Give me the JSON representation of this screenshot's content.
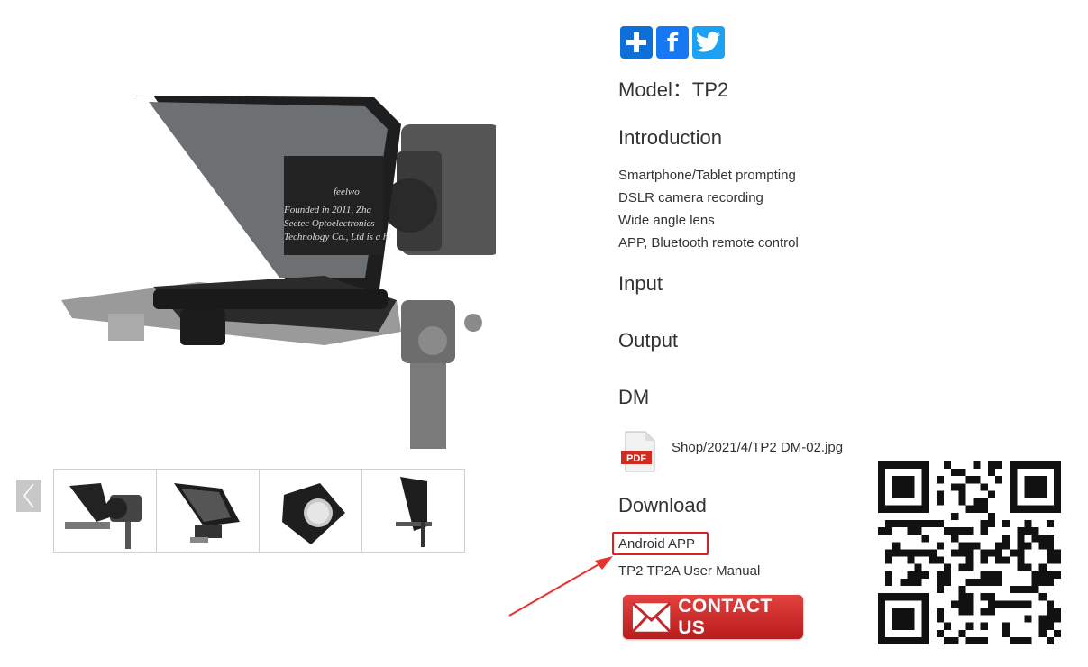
{
  "share": {
    "add_icon": "plus-icon",
    "facebook_icon": "facebook-icon",
    "twitter_icon": "twitter-icon",
    "colors": {
      "add": "#0e6fd6",
      "facebook": "#1877f2",
      "twitter": "#1da1f2"
    }
  },
  "product": {
    "model_label": "Model：TP2",
    "photo_text_lines": [
      "feelwo",
      "Founded in 2011, Zha",
      "Seetec Optoelectronics",
      "Technology Co., Ltd is a hi"
    ]
  },
  "introduction": {
    "heading": "Introduction",
    "items": [
      "Smartphone/Tablet prompting",
      "DSLR camera recording",
      "Wide angle lens",
      "APP, Bluetooth remote control"
    ]
  },
  "input": {
    "heading": "Input"
  },
  "output": {
    "heading": "Output"
  },
  "dm": {
    "heading": "DM",
    "file_icon_label": "PDF",
    "file_link": "Shop/2021/4/TP2 DM-02.jpg"
  },
  "download": {
    "heading": "Download",
    "android_app": "Android APP",
    "manual": "TP2 TP2A User Manual",
    "highlight_color": "#e02020"
  },
  "contact": {
    "label": "CONTACT US",
    "icon": "envelope-icon",
    "color": "#c8252a"
  },
  "thumbnails": {
    "prev_icon": "chevron-left-icon",
    "count": 4
  },
  "annotation": {
    "arrow_color": "#e8322d"
  }
}
